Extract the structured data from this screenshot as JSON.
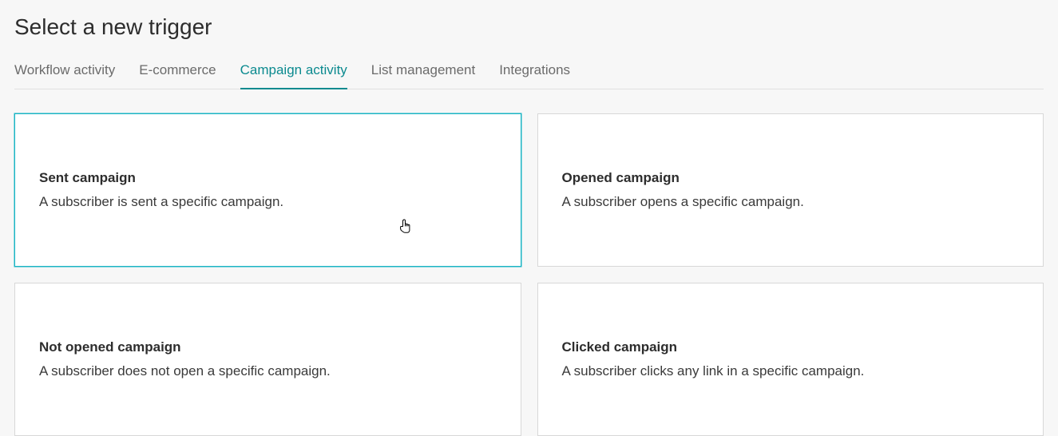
{
  "header": {
    "title": "Select a new trigger"
  },
  "tabs": [
    {
      "label": "Workflow activity"
    },
    {
      "label": "E-commerce"
    },
    {
      "label": "Campaign activity"
    },
    {
      "label": "List management"
    },
    {
      "label": "Integrations"
    }
  ],
  "active_tab_index": 2,
  "selected_card_index": 0,
  "cards": [
    {
      "title": "Sent campaign",
      "desc": "A subscriber is sent a specific campaign."
    },
    {
      "title": "Opened campaign",
      "desc": "A subscriber opens a specific campaign."
    },
    {
      "title": "Not opened campaign",
      "desc": "A subscriber does not open a specific campaign."
    },
    {
      "title": "Clicked campaign",
      "desc": "A subscriber clicks any link in a specific campaign."
    }
  ]
}
